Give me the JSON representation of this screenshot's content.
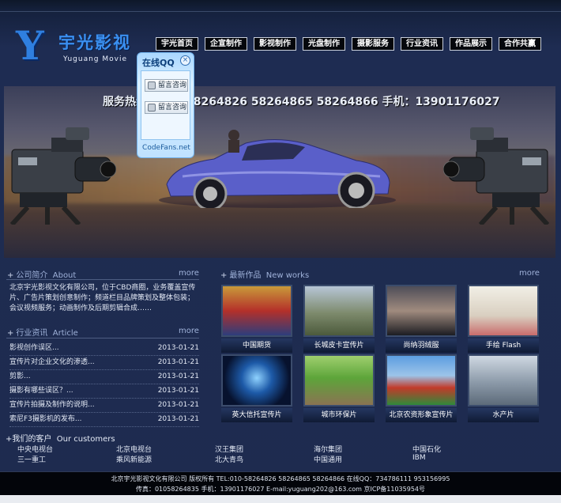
{
  "logo": {
    "mark": "Y",
    "name_cn": "宇光影视",
    "name_en": "Yuguang   Movie"
  },
  "nav": [
    "宇光首页",
    "企宣制作",
    "影视制作",
    "光盘制作",
    "摄影服务",
    "行业资讯",
    "作品展示",
    "合作共赢"
  ],
  "qq_float": {
    "title": "在线QQ",
    "close": "×",
    "buttons": [
      "留言咨询",
      "留言咨询"
    ],
    "footer": "CodeFans.net"
  },
  "banner": {
    "hotline": "服务热线：010-58264826 58264865 58264866   手机：13901176027"
  },
  "about": {
    "title": "公司简介",
    "title_en": "About",
    "more": "more",
    "text": "北京宇光影视文化有限公司，位于CBD商圈，业务覆盖宣传片、广告片策划创意制作；频道栏目品牌策划及整体包装；会议视频服务；动画制作及后期剪辑合成……"
  },
  "articles": {
    "title": "行业资讯",
    "title_en": "Article",
    "more": "more",
    "items": [
      {
        "title": "影视创作误区...",
        "date": "2013-01-21"
      },
      {
        "title": "宣传片对企业文化的渗透...",
        "date": "2013-01-21"
      },
      {
        "title": "剪影...",
        "date": "2013-01-21"
      },
      {
        "title": "摄影有哪些误区？...",
        "date": "2013-01-21"
      },
      {
        "title": "宣传片拍摄及制作的说明...",
        "date": "2013-01-21"
      },
      {
        "title": "索尼F3摄影机的发布...",
        "date": "2013-01-21"
      }
    ]
  },
  "works": {
    "title": "最新作品",
    "title_en": "New works",
    "more": "more",
    "items": [
      "中国期货",
      "长城皮卡宣传片",
      "尚纳羽绒服",
      "手绘 Flash",
      "英大信托宣传片",
      "城市环保片",
      "北京农资形象宣传片",
      "水产片"
    ]
  },
  "customers": {
    "title": "我们的客户",
    "title_en": "Our customers",
    "row1": [
      "中央电视台",
      "北京电视台",
      "汉王集团",
      "海尔集团",
      "中国石化"
    ],
    "row2": [
      "三一重工",
      "乘风新能源",
      "北大青鸟",
      "中国通用",
      "IBM"
    ]
  },
  "footer": {
    "line1": "北京宇光影视文化有限公司 版权所有 TEL:010-58264826 58264865 58264866 在线QQ：734786111 953156995",
    "line2": "传真：01058264835 手机：13901176027 E-mail:yuguang202@163.com 京ICP备11035954号"
  },
  "colors": {
    "nav_bg": "#05070c",
    "page_bg": "#1e2b4f",
    "logo": "#2f7fe0"
  }
}
